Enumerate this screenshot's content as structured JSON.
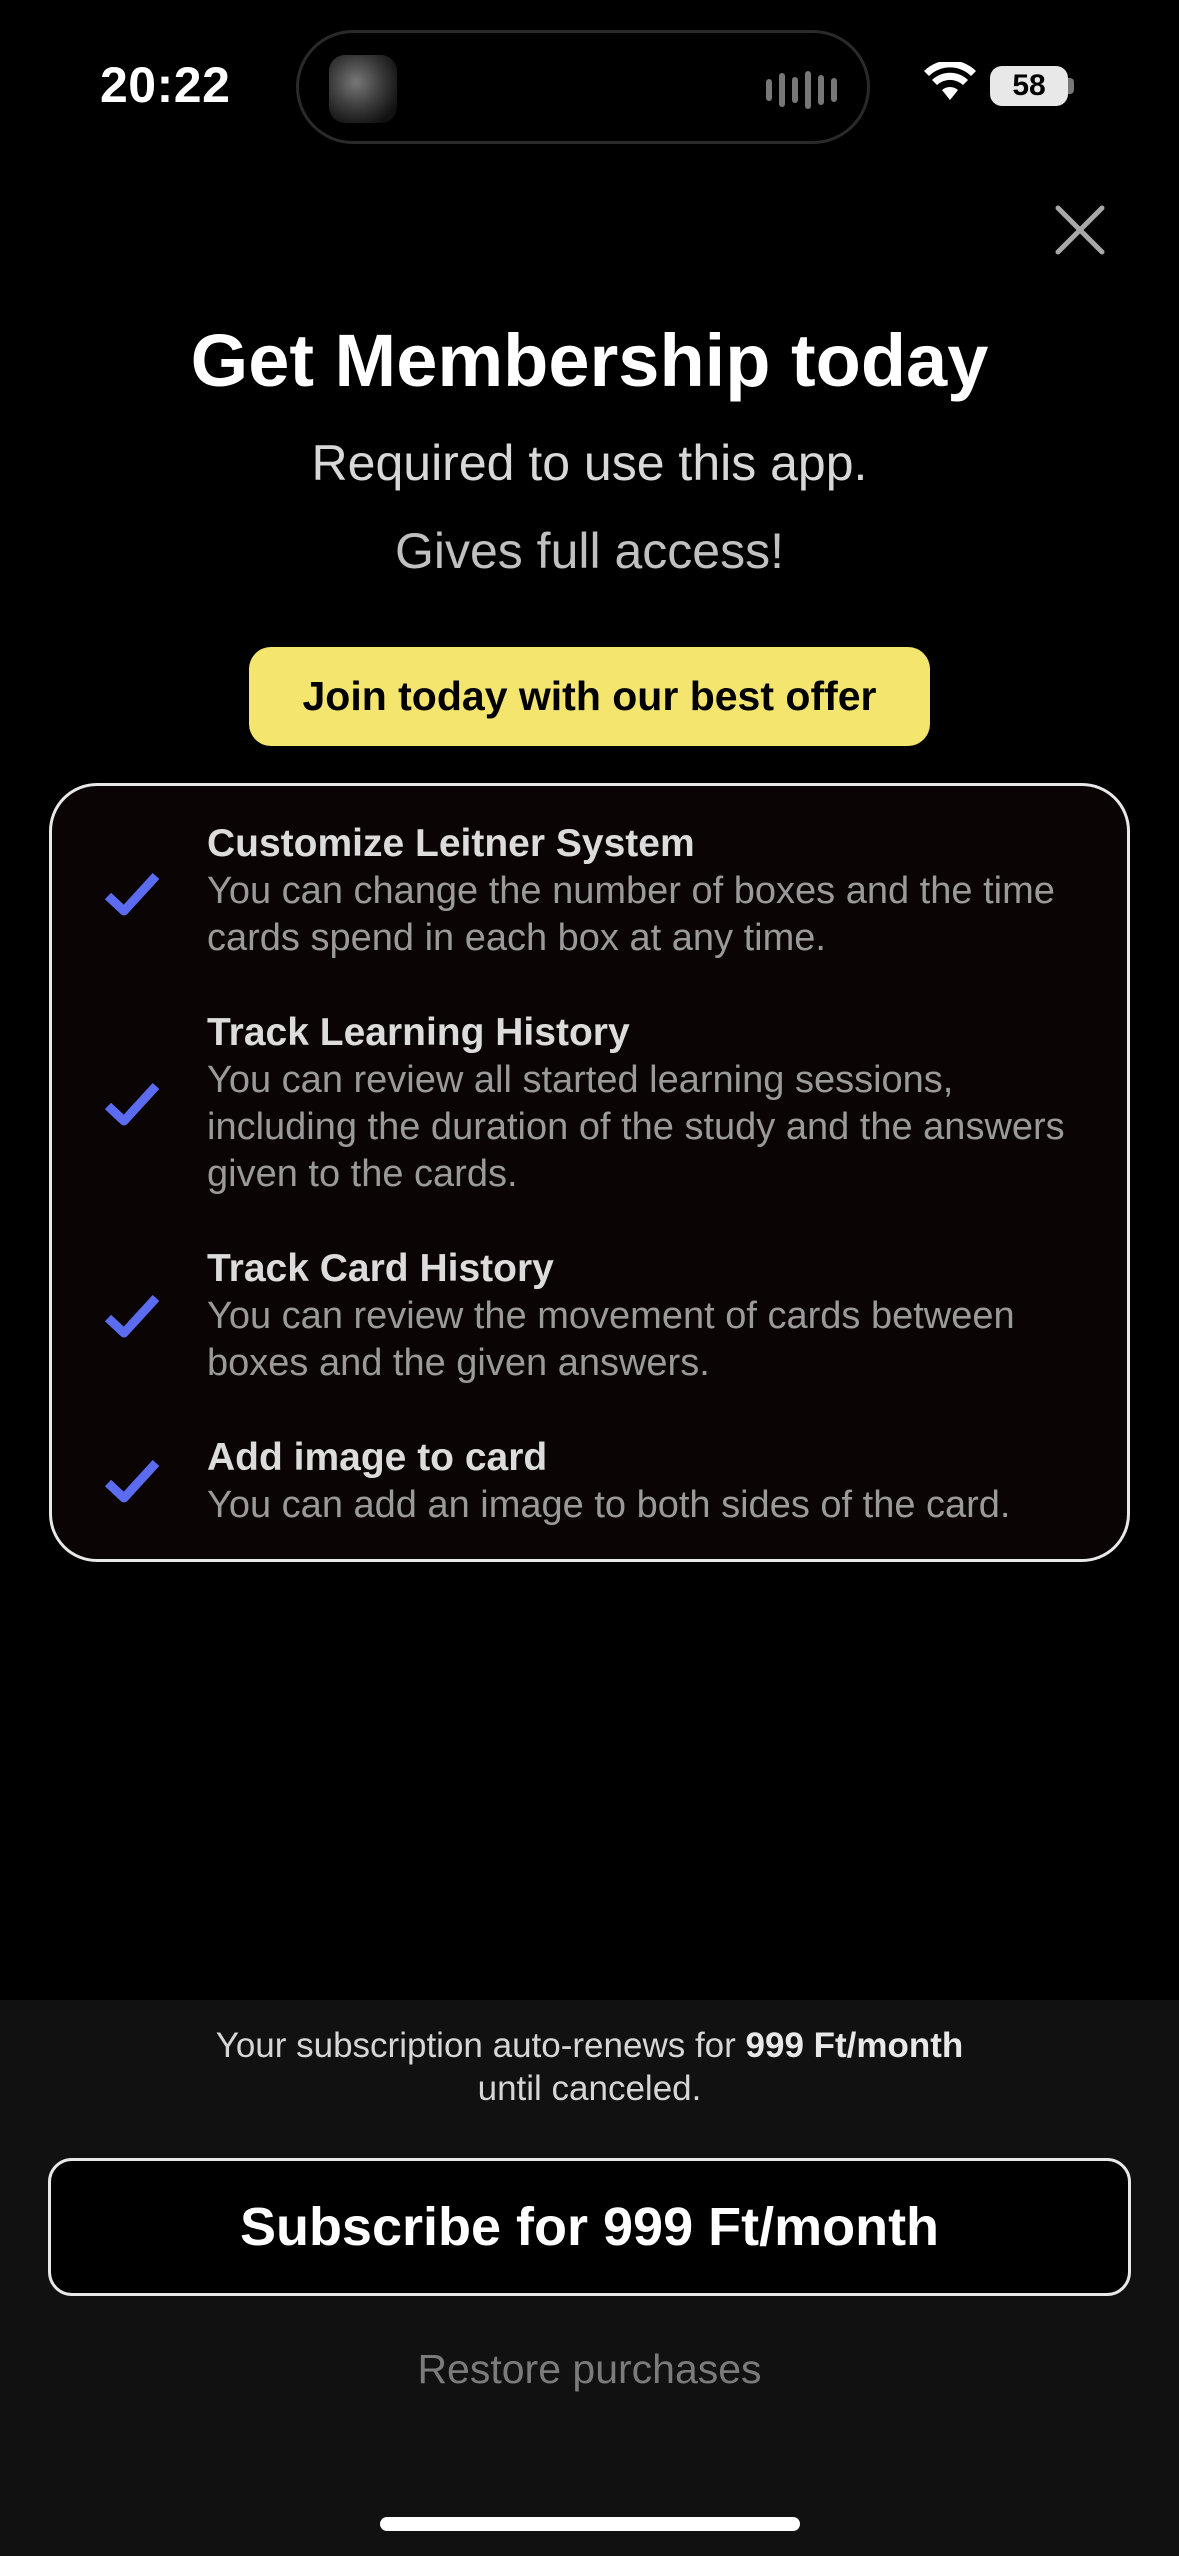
{
  "status_bar": {
    "time": "20:22",
    "battery": "58"
  },
  "header": {
    "title": "Get Membership today",
    "subtitle_line1": "Required to use this app.",
    "subtitle_line2": "Gives full access!",
    "offer_badge": "Join today with our best offer"
  },
  "features": [
    {
      "title": "Customize Leitner System",
      "description": "You can change the number of boxes and the time cards spend in each box at any time."
    },
    {
      "title": "Track Learning History",
      "description": "You can review all started learning sessions, including the duration of the study and the answers given to the cards."
    },
    {
      "title": "Track Card History",
      "description": "You can review the movement of cards between boxes and the given answers."
    },
    {
      "title": "Add image to card",
      "description": "You can add an image to both sides of the card."
    }
  ],
  "footer": {
    "renew_prefix": "Your subscription auto-renews for ",
    "renew_price": "999 Ft/month",
    "renew_suffix": "until canceled.",
    "subscribe_label": "Subscribe for 999 Ft/month",
    "restore_label": "Restore purchases"
  },
  "colors": {
    "accent_check": "#5b6cf0",
    "offer_bg": "#f3e56e"
  },
  "icons": {
    "close": "close-icon",
    "check": "checkmark-icon",
    "wifi": "wifi-icon",
    "battery": "battery-icon"
  }
}
